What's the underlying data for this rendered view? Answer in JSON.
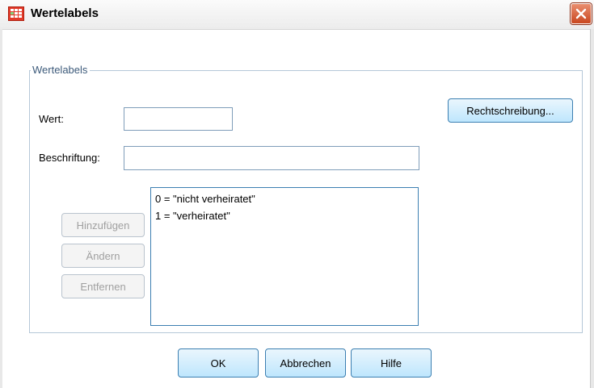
{
  "window": {
    "title": "Wertelabels"
  },
  "group": {
    "legend": "Wertelabels"
  },
  "fields": {
    "value_label": "Wert:",
    "value_input": "",
    "caption_label": "Beschriftung:",
    "caption_input": ""
  },
  "buttons": {
    "spelling": "Rechtschreibung...",
    "add": "Hinzufügen",
    "change": "Ändern",
    "remove": "Entfernen",
    "ok": "OK",
    "cancel": "Abbrechen",
    "help": "Hilfe"
  },
  "labels_list": [
    "0 = \"nicht verheiratet\"",
    "1 = \"verheiratet\""
  ],
  "colors": {
    "button_border": "#3c7fb1",
    "group_border": "#b5c7d8",
    "close_button": "#c9471f"
  }
}
